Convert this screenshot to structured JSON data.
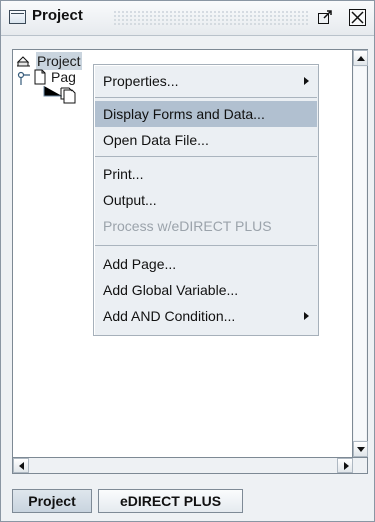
{
  "window": {
    "title": "Project",
    "accent": "#b1c0d0"
  },
  "icons": {
    "window": "window-icon",
    "float": "float-window-icon",
    "close": "close-icon",
    "project": "project-icon",
    "page": "page-icon",
    "forms": "forms-icon"
  },
  "tree": {
    "project_label": "Project",
    "page_label": "Pag"
  },
  "context_menu": {
    "items": [
      {
        "label": "Properties...",
        "state": "normal",
        "submenu": true
      },
      {
        "label": "Display Forms and Data...",
        "state": "highlighted",
        "submenu": false
      },
      {
        "label": "Open Data File...",
        "state": "normal",
        "submenu": false
      },
      {
        "label": "Print...",
        "state": "normal",
        "submenu": false
      },
      {
        "label": "Output...",
        "state": "normal",
        "submenu": false
      },
      {
        "label": "Process w/eDIRECT PLUS",
        "state": "disabled",
        "submenu": false
      },
      {
        "label": "Add Page...",
        "state": "normal",
        "submenu": false
      },
      {
        "label": "Add Global Variable...",
        "state": "normal",
        "submenu": false
      },
      {
        "label": "Add AND Condition...",
        "state": "normal",
        "submenu": true
      }
    ]
  },
  "tabs": [
    {
      "label": "Project",
      "selected": true
    },
    {
      "label": "eDIRECT PLUS",
      "selected": false
    }
  ]
}
